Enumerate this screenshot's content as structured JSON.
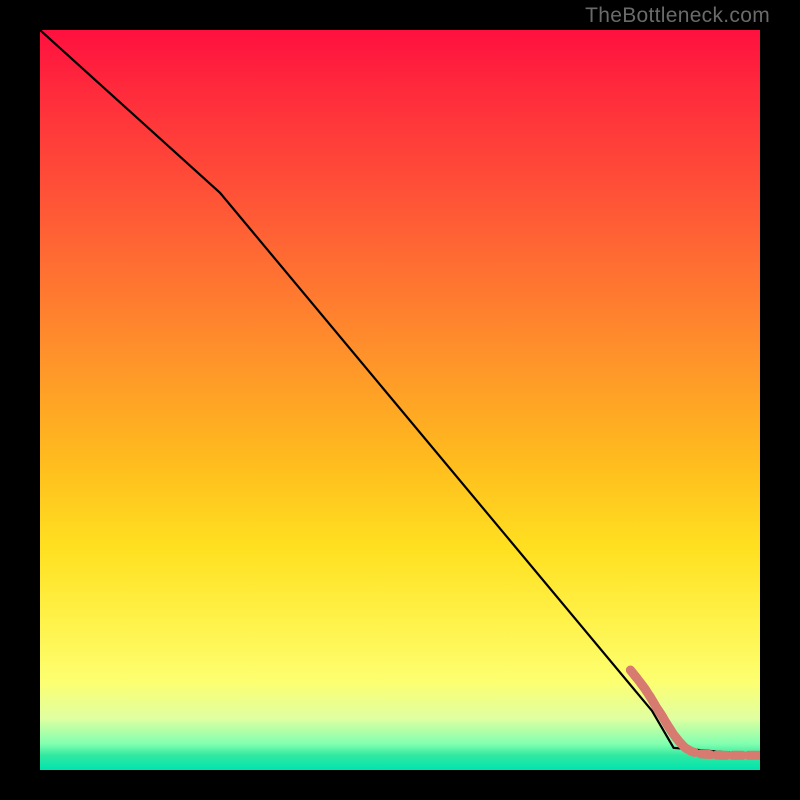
{
  "watermark": {
    "text": "TheBottleneck.com"
  },
  "chart_data": {
    "type": "line",
    "title": "",
    "xlabel": "",
    "ylabel": "",
    "xlim": [
      0,
      100
    ],
    "ylim": [
      0,
      100
    ],
    "grid": false,
    "curve": {
      "points": [
        {
          "x": 0,
          "y": 100
        },
        {
          "x": 25,
          "y": 78
        },
        {
          "x": 85,
          "y": 8
        },
        {
          "x": 88,
          "y": 3
        },
        {
          "x": 100,
          "y": 2
        }
      ]
    },
    "dotted_tail": {
      "color": "#d77a6f",
      "points": [
        {
          "x": 82,
          "y": 13.5
        },
        {
          "x": 83,
          "y": 12.3
        },
        {
          "x": 84,
          "y": 11.0
        },
        {
          "x": 84.8,
          "y": 9.8
        },
        {
          "x": 85.6,
          "y": 8.5
        },
        {
          "x": 86.4,
          "y": 7.3
        },
        {
          "x": 87.2,
          "y": 6.0
        },
        {
          "x": 88.0,
          "y": 4.8
        },
        {
          "x": 88.8,
          "y": 3.8
        },
        {
          "x": 89.6,
          "y": 3.0
        },
        {
          "x": 90.5,
          "y": 2.5
        },
        {
          "x": 91.5,
          "y": 2.2
        },
        {
          "x": 93.0,
          "y": 2.1
        },
        {
          "x": 94.5,
          "y": 2.0
        },
        {
          "x": 96.0,
          "y": 2.0
        },
        {
          "x": 97.5,
          "y": 2.0
        },
        {
          "x": 99.0,
          "y": 2.0
        },
        {
          "x": 100.0,
          "y": 2.0
        }
      ]
    }
  }
}
